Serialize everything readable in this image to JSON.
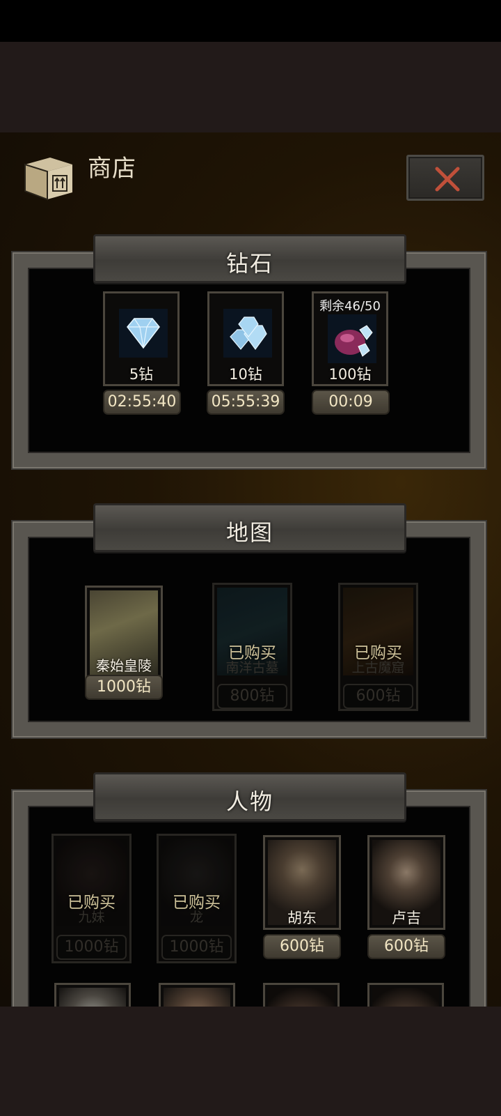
{
  "header": {
    "title": "商店",
    "close_icon": "close-icon",
    "box_icon": "package-box-icon"
  },
  "colors": {
    "accent_close": "#c0503a",
    "pill_text": "#f2e6c4",
    "bought_text": "#f0e2b2"
  },
  "sections": {
    "diamond": {
      "title": "钻石",
      "items": [
        {
          "label": "5钻",
          "timer": "02:55:40",
          "remain": "",
          "icon": "diamond-icon"
        },
        {
          "label": "10钻",
          "timer": "05:55:39",
          "remain": "",
          "icon": "diamond-pile-icon"
        },
        {
          "label": "100钻",
          "timer": "00:09",
          "remain": "剩余46/50",
          "icon": "diamond-bag-icon"
        }
      ]
    },
    "map": {
      "title": "地图",
      "items": [
        {
          "name": "秦始皇陵",
          "price": "1000钻",
          "status": ""
        },
        {
          "name": "南洋古墓",
          "price": "800钻",
          "status": "已购买"
        },
        {
          "name": "上古魔窟",
          "price": "600钻",
          "status": "已购买"
        }
      ]
    },
    "character": {
      "title": "人物",
      "items": [
        {
          "name": "九妹",
          "price": "1000钻",
          "status": "已购买"
        },
        {
          "name": "龙",
          "price": "1000钻",
          "status": "已购买"
        },
        {
          "name": "胡东",
          "price": "600钻",
          "status": ""
        },
        {
          "name": "卢吉",
          "price": "600钻",
          "status": ""
        }
      ]
    }
  }
}
